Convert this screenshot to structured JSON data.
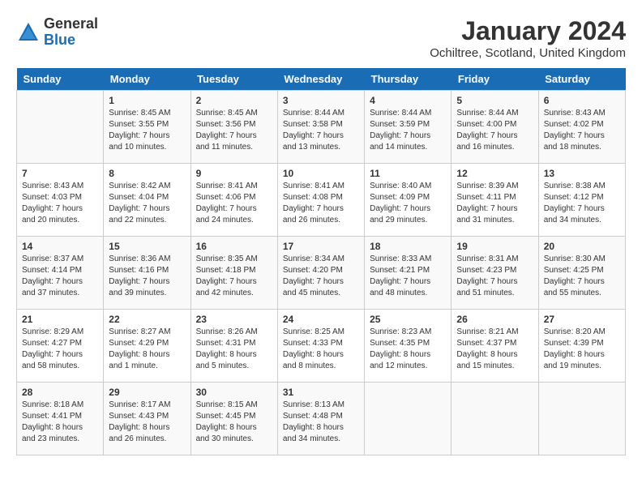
{
  "logo": {
    "general": "General",
    "blue": "Blue"
  },
  "title": "January 2024",
  "location": "Ochiltree, Scotland, United Kingdom",
  "days": [
    "Sunday",
    "Monday",
    "Tuesday",
    "Wednesday",
    "Thursday",
    "Friday",
    "Saturday"
  ],
  "weeks": [
    [
      {
        "num": "",
        "info": ""
      },
      {
        "num": "1",
        "info": "Sunrise: 8:45 AM\nSunset: 3:55 PM\nDaylight: 7 hours\nand 10 minutes."
      },
      {
        "num": "2",
        "info": "Sunrise: 8:45 AM\nSunset: 3:56 PM\nDaylight: 7 hours\nand 11 minutes."
      },
      {
        "num": "3",
        "info": "Sunrise: 8:44 AM\nSunset: 3:58 PM\nDaylight: 7 hours\nand 13 minutes."
      },
      {
        "num": "4",
        "info": "Sunrise: 8:44 AM\nSunset: 3:59 PM\nDaylight: 7 hours\nand 14 minutes."
      },
      {
        "num": "5",
        "info": "Sunrise: 8:44 AM\nSunset: 4:00 PM\nDaylight: 7 hours\nand 16 minutes."
      },
      {
        "num": "6",
        "info": "Sunrise: 8:43 AM\nSunset: 4:02 PM\nDaylight: 7 hours\nand 18 minutes."
      }
    ],
    [
      {
        "num": "7",
        "info": "Sunrise: 8:43 AM\nSunset: 4:03 PM\nDaylight: 7 hours\nand 20 minutes."
      },
      {
        "num": "8",
        "info": "Sunrise: 8:42 AM\nSunset: 4:04 PM\nDaylight: 7 hours\nand 22 minutes."
      },
      {
        "num": "9",
        "info": "Sunrise: 8:41 AM\nSunset: 4:06 PM\nDaylight: 7 hours\nand 24 minutes."
      },
      {
        "num": "10",
        "info": "Sunrise: 8:41 AM\nSunset: 4:08 PM\nDaylight: 7 hours\nand 26 minutes."
      },
      {
        "num": "11",
        "info": "Sunrise: 8:40 AM\nSunset: 4:09 PM\nDaylight: 7 hours\nand 29 minutes."
      },
      {
        "num": "12",
        "info": "Sunrise: 8:39 AM\nSunset: 4:11 PM\nDaylight: 7 hours\nand 31 minutes."
      },
      {
        "num": "13",
        "info": "Sunrise: 8:38 AM\nSunset: 4:12 PM\nDaylight: 7 hours\nand 34 minutes."
      }
    ],
    [
      {
        "num": "14",
        "info": "Sunrise: 8:37 AM\nSunset: 4:14 PM\nDaylight: 7 hours\nand 37 minutes."
      },
      {
        "num": "15",
        "info": "Sunrise: 8:36 AM\nSunset: 4:16 PM\nDaylight: 7 hours\nand 39 minutes."
      },
      {
        "num": "16",
        "info": "Sunrise: 8:35 AM\nSunset: 4:18 PM\nDaylight: 7 hours\nand 42 minutes."
      },
      {
        "num": "17",
        "info": "Sunrise: 8:34 AM\nSunset: 4:20 PM\nDaylight: 7 hours\nand 45 minutes."
      },
      {
        "num": "18",
        "info": "Sunrise: 8:33 AM\nSunset: 4:21 PM\nDaylight: 7 hours\nand 48 minutes."
      },
      {
        "num": "19",
        "info": "Sunrise: 8:31 AM\nSunset: 4:23 PM\nDaylight: 7 hours\nand 51 minutes."
      },
      {
        "num": "20",
        "info": "Sunrise: 8:30 AM\nSunset: 4:25 PM\nDaylight: 7 hours\nand 55 minutes."
      }
    ],
    [
      {
        "num": "21",
        "info": "Sunrise: 8:29 AM\nSunset: 4:27 PM\nDaylight: 7 hours\nand 58 minutes."
      },
      {
        "num": "22",
        "info": "Sunrise: 8:27 AM\nSunset: 4:29 PM\nDaylight: 8 hours\nand 1 minute."
      },
      {
        "num": "23",
        "info": "Sunrise: 8:26 AM\nSunset: 4:31 PM\nDaylight: 8 hours\nand 5 minutes."
      },
      {
        "num": "24",
        "info": "Sunrise: 8:25 AM\nSunset: 4:33 PM\nDaylight: 8 hours\nand 8 minutes."
      },
      {
        "num": "25",
        "info": "Sunrise: 8:23 AM\nSunset: 4:35 PM\nDaylight: 8 hours\nand 12 minutes."
      },
      {
        "num": "26",
        "info": "Sunrise: 8:21 AM\nSunset: 4:37 PM\nDaylight: 8 hours\nand 15 minutes."
      },
      {
        "num": "27",
        "info": "Sunrise: 8:20 AM\nSunset: 4:39 PM\nDaylight: 8 hours\nand 19 minutes."
      }
    ],
    [
      {
        "num": "28",
        "info": "Sunrise: 8:18 AM\nSunset: 4:41 PM\nDaylight: 8 hours\nand 23 minutes."
      },
      {
        "num": "29",
        "info": "Sunrise: 8:17 AM\nSunset: 4:43 PM\nDaylight: 8 hours\nand 26 minutes."
      },
      {
        "num": "30",
        "info": "Sunrise: 8:15 AM\nSunset: 4:45 PM\nDaylight: 8 hours\nand 30 minutes."
      },
      {
        "num": "31",
        "info": "Sunrise: 8:13 AM\nSunset: 4:48 PM\nDaylight: 8 hours\nand 34 minutes."
      },
      {
        "num": "",
        "info": ""
      },
      {
        "num": "",
        "info": ""
      },
      {
        "num": "",
        "info": ""
      }
    ]
  ]
}
